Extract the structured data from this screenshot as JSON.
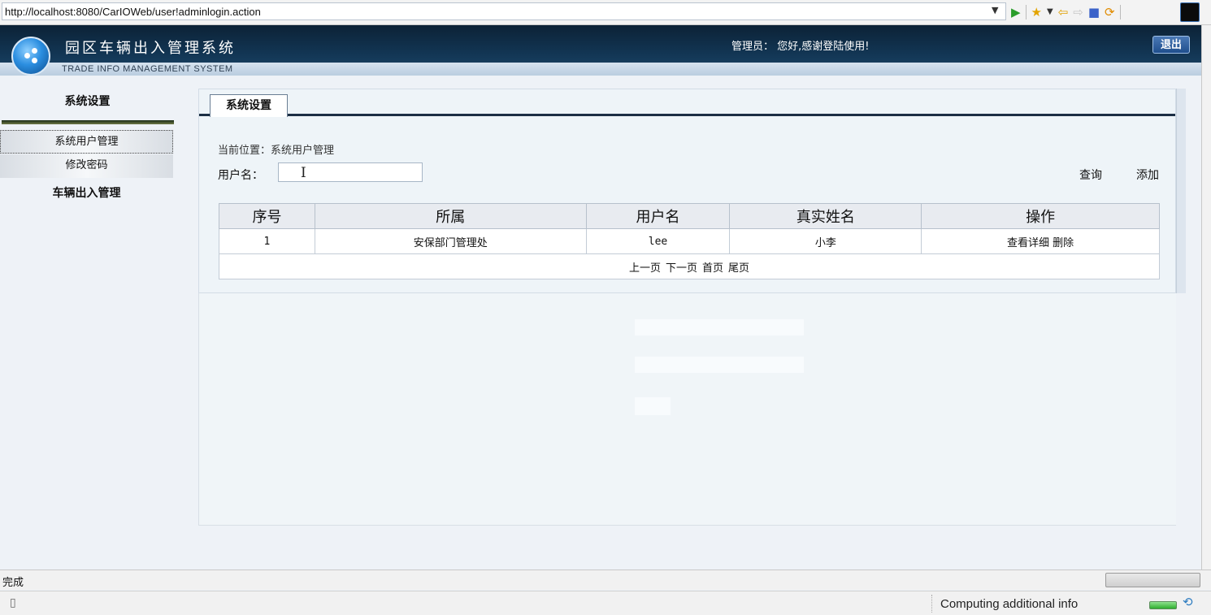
{
  "browser": {
    "url": "http://localhost:8080/CarIOWeb/user!adminlogin.action",
    "toolbar_icons": [
      "play-icon",
      "star-icon",
      "back-arrow-icon",
      "forward-arrow-icon",
      "stop-icon",
      "refresh-icon"
    ]
  },
  "header": {
    "title": "园区车辆出入管理系统",
    "subtitle": "TRADE INFO MANAGEMENT SYSTEM",
    "admin_greeting": "管理员：  您好,感谢登陆使用!",
    "logout_label": "退出"
  },
  "sidebar": {
    "heading_system": "系统设置",
    "items": [
      {
        "label": "系统用户管理",
        "selected": true
      },
      {
        "label": "修改密码",
        "selected": false
      }
    ],
    "heading_vehicle": "车辆出入管理"
  },
  "main": {
    "tab_label": "系统设置",
    "breadcrumb": "当前位置：系统用户管理",
    "search": {
      "label": "用户名：",
      "value": "",
      "query_label": "查询",
      "add_label": "添加"
    },
    "table": {
      "headers": [
        "序号",
        "所属",
        "用户名",
        "真实姓名",
        "操作"
      ],
      "rows": [
        {
          "index": "1",
          "department": "安保部门管理处",
          "username": "lee",
          "realname": "小李",
          "view": "查看详细",
          "delete": "删除"
        }
      ]
    },
    "pager": {
      "prev": "上一页",
      "next": "下一页",
      "first": "首页",
      "last": "尾页"
    }
  },
  "status": {
    "left_text": "完成",
    "right_text": "Computing additional info"
  },
  "colors": {
    "header_dark": "#0c2236",
    "accent_blue": "#1f4e8c",
    "table_header_bg": "#e8ebf0"
  }
}
